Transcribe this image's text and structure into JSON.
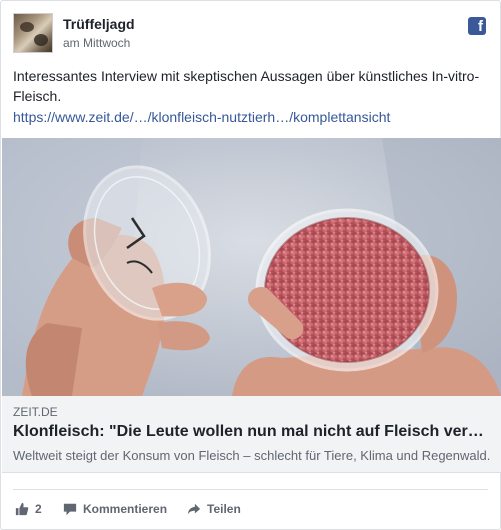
{
  "post": {
    "author": "Trüffeljagd",
    "time": "am Mittwoch",
    "text": "Interessantes Interview mit skeptischen Aussagen über künstliches In-vitro-Fleisch.",
    "link": "https://www.zeit.de/…/klonfleisch-nutztierh…/komplettansicht"
  },
  "attachment": {
    "domain": "ZEIT.DE",
    "headline": "Klonfleisch: \"Die Leute wollen nun mal nicht auf Fleisch verzichten\"",
    "description": "Weltweit steigt der Konsum von Fleisch – schlecht für Tiere, Klima und Regenwald."
  },
  "actions": {
    "like_count": "2",
    "comment_label": "Kommentieren",
    "share_label": "Teilen"
  },
  "icons": {
    "platform": "facebook-icon",
    "like": "thumbs-up-icon",
    "comment": "comment-icon",
    "share": "share-arrow-icon"
  },
  "colors": {
    "link": "#365899",
    "brand": "#3b5998",
    "muted": "#606770"
  }
}
